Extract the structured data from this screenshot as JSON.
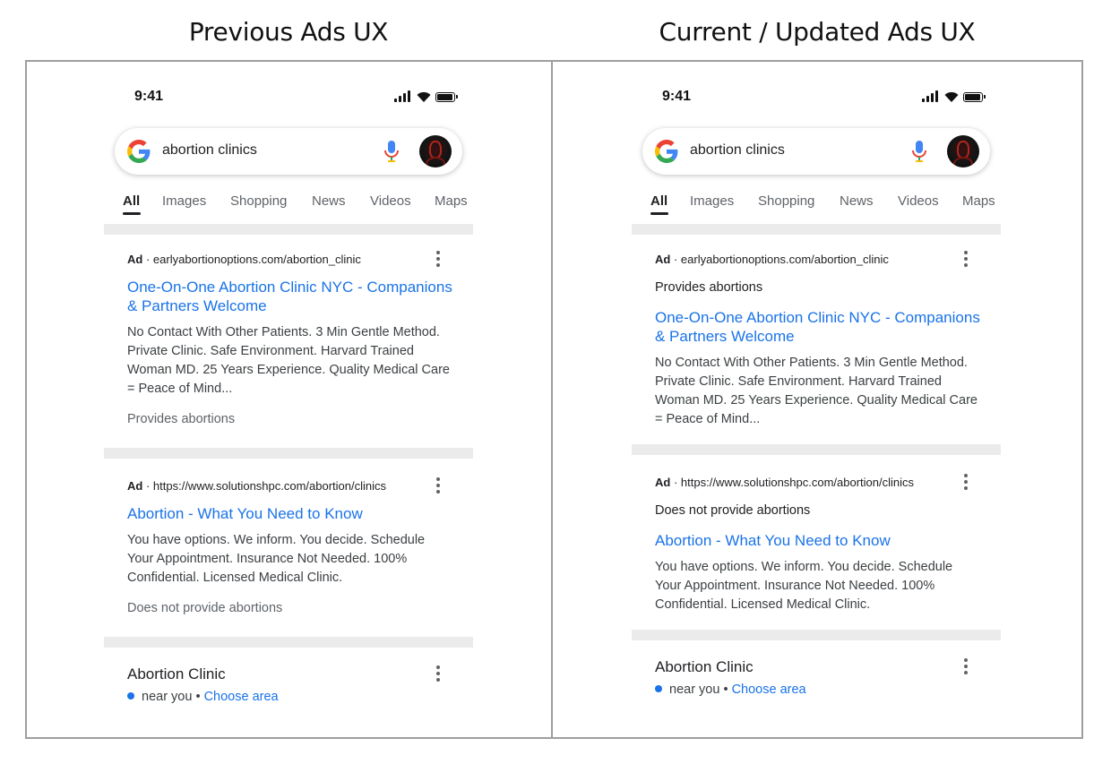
{
  "titles": {
    "left": "Previous Ads UX",
    "right": "Current / Updated Ads UX"
  },
  "colors": {
    "link": "#1a73e8",
    "separator": "#ebebeb",
    "frame": "#9e9e9e"
  },
  "phones": [
    {
      "status": {
        "time": "9:41"
      },
      "search": {
        "query": "abortion clinics",
        "icons": [
          "google-g-icon",
          "mic-icon",
          "avatar"
        ]
      },
      "tabs": [
        {
          "label": "All",
          "active": true
        },
        {
          "label": "Images"
        },
        {
          "label": "Shopping"
        },
        {
          "label": "News"
        },
        {
          "label": "Videos"
        },
        {
          "label": "Maps"
        }
      ],
      "ads": [
        {
          "ad_label": "Ad",
          "url": "earlyabortionoptions.com/abortion_clinic",
          "title_lines": [
            "One-On-One Abortion Clinic NYC - Companions",
            "& Partners Welcome"
          ],
          "desc_lines": [
            "No Contact With Other Patients. 3 Min Gentle Method.",
            "Private Clinic. Safe Environment. Harvard Trained",
            "Woman MD. 25 Years Experience. Quality Medical Care",
            "= Peace of Mind..."
          ],
          "disclosure": "Provides abortions"
        },
        {
          "ad_label": "Ad",
          "url": "https://www.solutionshpc.com/abortion/clinics",
          "title_lines": [
            "Abortion - What You Need to Know"
          ],
          "desc_lines": [
            "You have options. We inform. You decide. Schedule",
            "Your Appointment. Insurance Not Needed. 100%",
            "Confidential. Licensed Medical Clinic."
          ],
          "disclosure": "Does not provide abortions"
        }
      ],
      "local": {
        "title": "Abortion Clinic",
        "near": "near you",
        "separator": "•",
        "choose": "Choose area"
      }
    },
    {
      "status": {
        "time": "9:41"
      },
      "search": {
        "query": "abortion clinics",
        "icons": [
          "google-g-icon",
          "mic-icon",
          "avatar"
        ]
      },
      "tabs": [
        {
          "label": "All",
          "active": true
        },
        {
          "label": "Images"
        },
        {
          "label": "Shopping"
        },
        {
          "label": "News"
        },
        {
          "label": "Videos"
        },
        {
          "label": "Maps"
        }
      ],
      "ads": [
        {
          "ad_label": "Ad",
          "url": "earlyabortionoptions.com/abortion_clinic",
          "title_lines": [
            "One-On-One Abortion Clinic NYC - Companions",
            "& Partners Welcome"
          ],
          "desc_lines": [
            "No Contact With Other Patients. 3 Min Gentle Method.",
            "Private Clinic. Safe Environment. Harvard Trained",
            "Woman MD. 25 Years Experience. Quality Medical Care",
            "= Peace of Mind..."
          ],
          "disclosure": "Provides abortions"
        },
        {
          "ad_label": "Ad",
          "url": "https://www.solutionshpc.com/abortion/clinics",
          "title_lines": [
            "Abortion - What You Need to Know"
          ],
          "desc_lines": [
            "You have options. We inform. You decide. Schedule",
            "Your Appointment. Insurance Not Needed. 100%",
            "Confidential. Licensed Medical Clinic."
          ],
          "disclosure": "Does not provide abortions"
        }
      ],
      "local": {
        "title": "Abortion Clinic",
        "near": "near you",
        "separator": "•",
        "choose": "Choose area"
      }
    }
  ]
}
